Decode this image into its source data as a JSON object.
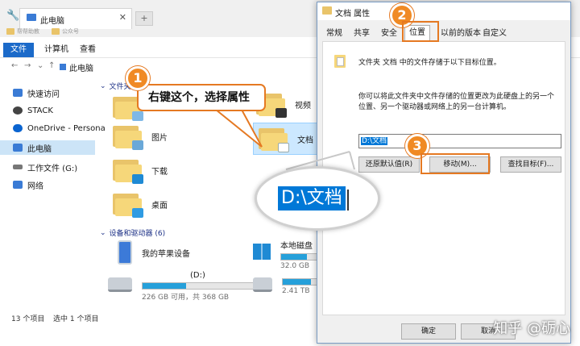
{
  "explorer": {
    "tab_title": "此电脑",
    "tab_close": "✕",
    "new_tab": "+",
    "bookmarks": [
      "帮帮助教",
      "公众号"
    ],
    "ribbon": [
      "文件",
      "计算机",
      "查看"
    ],
    "nav": {
      "back": "←",
      "forward": "→",
      "down": "⌄",
      "up": "↑"
    },
    "breadcrumb": "此电脑",
    "sidebar": [
      {
        "label": "快速访问",
        "color": "#3a7bd5"
      },
      {
        "label": "STACK",
        "color": "#444444"
      },
      {
        "label": "OneDrive - Persona",
        "color": "#0a64d0"
      },
      {
        "label": "此电脑",
        "color": "#3a7bd5"
      },
      {
        "label": "工作文件 (G:)",
        "color": "#777777"
      },
      {
        "label": "网络",
        "color": "#3a7bd5"
      }
    ],
    "section_folders": "文件夹",
    "folders_left": [
      "图片",
      "下载",
      "桌面"
    ],
    "folders_right": [
      "视频",
      "文档"
    ],
    "section_devices": "设备和驱动器 (6)",
    "devices": [
      {
        "name": "我的苹果设备",
        "sub": ""
      },
      {
        "name": "(D:)",
        "sub": "226 GB 可用，共 368 GB",
        "used": 0.39
      },
      {
        "name": "本地磁盘",
        "sub": "32.0 GB",
        "used": 0.55
      },
      {
        "name": "",
        "sub": "2.41 TB",
        "used": 0.6
      }
    ],
    "status_count": "13 个项目",
    "status_selected": "选中 1 个项目"
  },
  "dialog": {
    "title": "文档 属性",
    "tabs": [
      "常规",
      "共享",
      "安全",
      "位置",
      "以前的版本",
      "自定义"
    ],
    "active_tab": "位置",
    "desc": "文件夹 文档 中的文件存储于以下目标位置。",
    "paragraph": "你可以将此文件夹中文件存储的位置更改为此硬盘上的另一个位置、另一个驱动器或网络上的另一台计算机。",
    "path_value": "D:\\文档",
    "buttons": {
      "restore": "还原默认值(R)",
      "move": "移动(M)...",
      "find": "查找目标(F)..."
    },
    "ok": "确定",
    "cancel": "取消"
  },
  "annotations": {
    "callout": "右键这个，选择属性",
    "steps": [
      "1",
      "2",
      "3"
    ],
    "magnified": "D:\\文档",
    "watermark": "知乎 @砺心"
  },
  "colors": {
    "accent": "#e57922",
    "select": "#0078d7",
    "ribbon": "#1b6ac9"
  }
}
